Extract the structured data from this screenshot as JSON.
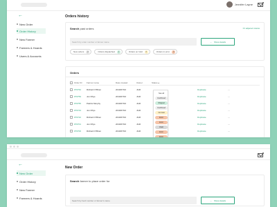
{
  "colors": {
    "accent": "#2aa57b",
    "background": "#8fd2b8"
  },
  "user": {
    "name": "Jennifer Layne",
    "mail_icon": "mail-icon"
  },
  "sidebar": {
    "items": [
      {
        "label": "New Order",
        "active": false
      },
      {
        "label": "Order History",
        "active": true
      },
      {
        "label": "New Farmer",
        "active": false
      },
      {
        "label": "Farmers & Hoards",
        "active": false
      },
      {
        "label": "Users & Accounts",
        "active": false
      }
    ]
  },
  "history": {
    "title": "Orders history",
    "search_label_bold": "Search",
    "search_label_rest": "past orders",
    "advanced_link": "Or adjacent status",
    "search_placeholder": "Search by order number or farmer name",
    "button_label": "Show details",
    "chips": [
      {
        "label": "New orders",
        "count": "2"
      },
      {
        "label": "Orders dispatched",
        "count": "1"
      },
      {
        "label": "Orders on hold",
        "count": "0"
      },
      {
        "label": "Orders in error",
        "count": "3"
      }
    ]
  },
  "orders": {
    "title": "Orders",
    "columns": [
      "Order ID",
      "Farmer name",
      "Date created",
      "Owner",
      "Status"
    ],
    "rows": [
      {
        "id": "#76762",
        "farmer": "Richard O'Brien",
        "date": "2019/07/02",
        "owner": "JGR",
        "action": "Duplicate"
      },
      {
        "id": "#76759",
        "farmer": "Jon Rhys",
        "date": "2019/07/02",
        "owner": "JGR",
        "action": "Duplicate"
      },
      {
        "id": "#76755",
        "farmer": "Patrick Murphy",
        "date": "2019/07/02",
        "owner": "JGR",
        "action": "Duplicate"
      },
      {
        "id": "#76743",
        "farmer": "Jon Rhys",
        "date": "2019/07/02",
        "owner": "JGR",
        "action": "Duplicate"
      },
      {
        "id": "#76722",
        "farmer": "Richard O'Brien",
        "date": "2019/07/02",
        "owner": "JGR",
        "action": "Duplicate"
      },
      {
        "id": "#76701",
        "farmer": "Jon Rhys",
        "date": "2019/07/02",
        "owner": "JGR",
        "action": "Duplicate"
      },
      {
        "id": "#76700",
        "farmer": "Richard O'Brien",
        "date": "2019/07/02",
        "owner": "JGR",
        "action": "Duplicate"
      }
    ],
    "status_options": [
      {
        "label": "See all",
        "color": "#ffffff"
      },
      {
        "label": "Confirmed",
        "color": "#eeeeee"
      },
      {
        "label": "Shipped",
        "color": "#cdeede"
      },
      {
        "label": "Confirmed",
        "color": "#eeeeee"
      },
      {
        "label": "On hold",
        "color": "#fff1c6"
      },
      {
        "label": "Error",
        "color": "#f5c4a8"
      },
      {
        "label": "Error",
        "color": "#f5c4a8"
      },
      {
        "label": "Draft",
        "color": "#d9d9d9"
      },
      {
        "label": "Error",
        "color": "#f5c4a8"
      },
      {
        "label": "Error",
        "color": "#f5c4a8"
      }
    ]
  },
  "new_order": {
    "title": "New Order",
    "search_label_bold": "Search",
    "search_label_rest": "farmer to place order for",
    "search_placeholder": "Search by herd number or farmer's name",
    "button_label": "Show details"
  }
}
